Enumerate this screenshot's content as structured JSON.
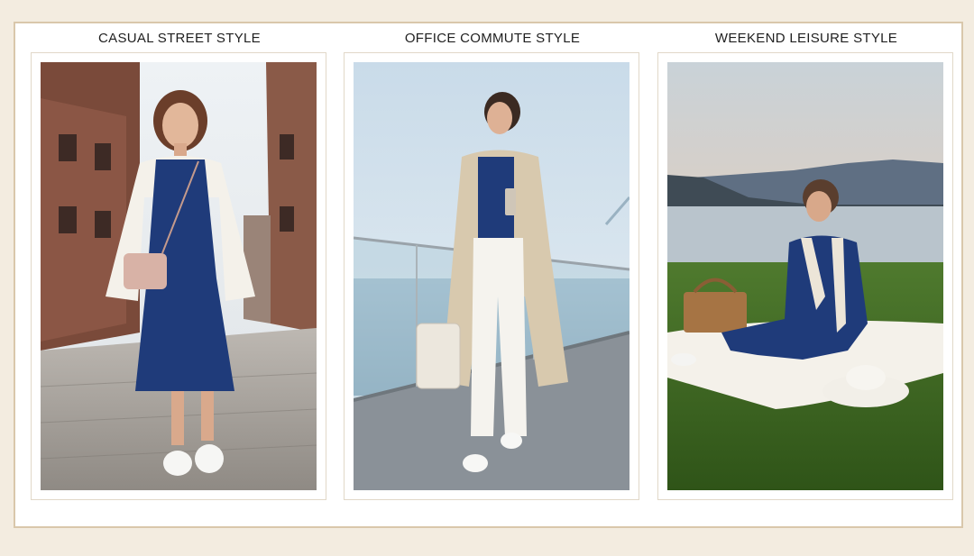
{
  "panels": [
    {
      "title": "CASUAL STREET STYLE"
    },
    {
      "title": "OFFICE COMMUTE STYLE"
    },
    {
      "title": "WEEKEND LEISURE STYLE"
    }
  ]
}
